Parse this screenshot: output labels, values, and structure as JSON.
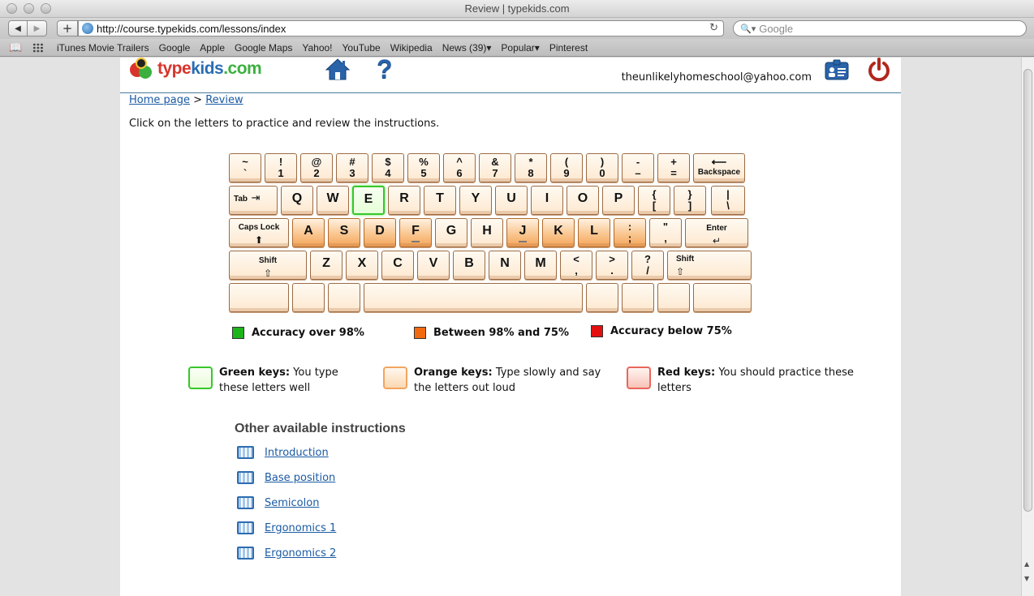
{
  "window": {
    "title": "Review | typekids.com"
  },
  "toolbar": {
    "url": "http://course.typekids.com/lessons/index",
    "search_placeholder": "Google"
  },
  "bookmarks": [
    "iTunes Movie Trailers",
    "Google",
    "Apple",
    "Google Maps",
    "Yahoo!",
    "YouTube",
    "Wikipedia",
    "News (39)▾",
    "Popular▾",
    "Pinterest"
  ],
  "header": {
    "logo_parts": [
      "type",
      "kids",
      ".com"
    ],
    "user_email": "theunlikelyhomeschool@yahoo.com"
  },
  "breadcrumb": {
    "home": "Home page",
    "sep": ">",
    "current": "Review"
  },
  "instruction": "Click on the letters to practice and review the instructions.",
  "keyboard": {
    "row1": [
      {
        "t": "~",
        "b": "`",
        "s": "plain"
      },
      {
        "t": "!",
        "b": "1",
        "s": "plain"
      },
      {
        "t": "@",
        "b": "2",
        "s": "plain"
      },
      {
        "t": "#",
        "b": "3",
        "s": "plain"
      },
      {
        "t": "$",
        "b": "4",
        "s": "plain"
      },
      {
        "t": "%",
        "b": "5",
        "s": "plain"
      },
      {
        "t": "^",
        "b": "6",
        "s": "plain"
      },
      {
        "t": "&",
        "b": "7",
        "s": "plain"
      },
      {
        "t": "*",
        "b": "8",
        "s": "plain"
      },
      {
        "t": "(",
        "b": "9",
        "s": "plain"
      },
      {
        "t": ")",
        "b": "0",
        "s": "plain"
      },
      {
        "t": "-",
        "b": "–",
        "s": "plain"
      },
      {
        "t": "+",
        "b": "=",
        "s": "plain"
      }
    ],
    "backspace": "Backspace",
    "tab": "Tab",
    "row2": [
      {
        "k": "Q",
        "s": "plain"
      },
      {
        "k": "W",
        "s": "plain"
      },
      {
        "k": "E",
        "s": "green"
      },
      {
        "k": "R",
        "s": "plain"
      },
      {
        "k": "T",
        "s": "plain"
      },
      {
        "k": "Y",
        "s": "plain"
      },
      {
        "k": "U",
        "s": "plain"
      },
      {
        "k": "I",
        "s": "plain"
      },
      {
        "k": "O",
        "s": "plain"
      },
      {
        "k": "P",
        "s": "plain"
      }
    ],
    "row2_sym": [
      {
        "t": "{",
        "b": "["
      },
      {
        "t": "}",
        "b": "]"
      },
      {
        "t": "|",
        "b": "\\"
      }
    ],
    "capslock": "Caps Lock",
    "row3": [
      {
        "k": "A",
        "s": "orange"
      },
      {
        "k": "S",
        "s": "orange"
      },
      {
        "k": "D",
        "s": "orange"
      },
      {
        "k": "F",
        "s": "orange"
      },
      {
        "k": "G",
        "s": "plain"
      },
      {
        "k": "H",
        "s": "plain"
      },
      {
        "k": "J",
        "s": "orange"
      },
      {
        "k": "K",
        "s": "orange"
      },
      {
        "k": "L",
        "s": "orange"
      }
    ],
    "row3_sym": [
      {
        "t": ":",
        "b": ";",
        "s": "orange"
      },
      {
        "t": "\"",
        "b": ",",
        "s": "plain"
      }
    ],
    "enter": "Enter",
    "shift": "Shift",
    "row4": [
      {
        "k": "Z"
      },
      {
        "k": "X"
      },
      {
        "k": "C"
      },
      {
        "k": "V"
      },
      {
        "k": "B"
      },
      {
        "k": "N"
      },
      {
        "k": "M"
      }
    ],
    "row4_sym": [
      {
        "t": "<",
        "b": ","
      },
      {
        "t": ">",
        "b": "."
      },
      {
        "t": "?",
        "b": "/"
      }
    ]
  },
  "legend": [
    {
      "label": "Accuracy over 98%",
      "color": "#1db31b"
    },
    {
      "label": "Between 98% and 75%",
      "color": "#f26a10"
    },
    {
      "label": "Accuracy below 75%",
      "color": "#e3100f"
    }
  ],
  "explanations": [
    {
      "title": "Green keys:",
      "text": "You type these letters well",
      "color": "#37c72a"
    },
    {
      "title": "Orange keys:",
      "text": "Type slowly and say the letters out loud",
      "color": "#f2a55e"
    },
    {
      "title": "Red keys:",
      "text": "You should practice these letters",
      "color": "#e9675a"
    }
  ],
  "other": {
    "title": "Other available instructions",
    "lessons": [
      "Introduction",
      "Base position",
      "Semicolon",
      "Ergonomics 1",
      "Ergonomics 2"
    ]
  }
}
